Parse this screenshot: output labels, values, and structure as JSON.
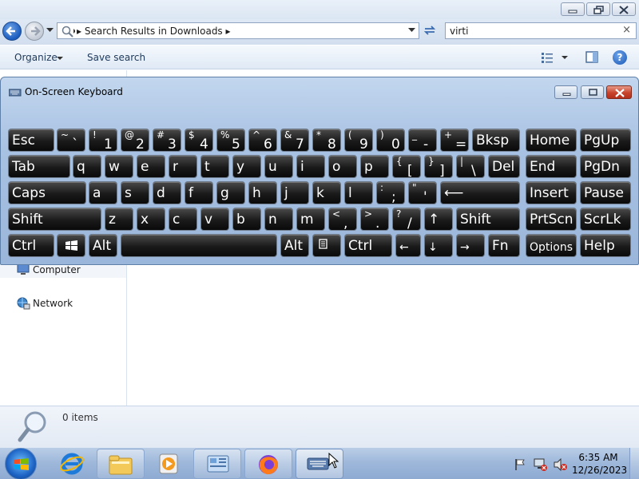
{
  "explorer": {
    "address": "Search Results in Downloads",
    "search_value": "virti",
    "search_clear": "×",
    "organize_label": "Organize",
    "save_search_label": "Save search",
    "help_label": "?",
    "nav_items": [
      {
        "label": "Computer"
      },
      {
        "label": "Network"
      }
    ],
    "details_count": "0 items"
  },
  "osk": {
    "title": "On-Screen Keyboard",
    "keys": [
      {
        "main": "Esc",
        "shift": "",
        "low": ""
      },
      {
        "main": "",
        "shift": "~",
        "low": "`"
      },
      {
        "main": "",
        "shift": "!",
        "low": "1"
      },
      {
        "main": "",
        "shift": "@",
        "low": "2"
      },
      {
        "main": "",
        "shift": "#",
        "low": "3"
      },
      {
        "main": "",
        "shift": "$",
        "low": "4"
      },
      {
        "main": "",
        "shift": "%",
        "low": "5"
      },
      {
        "main": "",
        "shift": "^",
        "low": "6"
      },
      {
        "main": "",
        "shift": "&",
        "low": "7"
      },
      {
        "main": "",
        "shift": "*",
        "low": "8"
      },
      {
        "main": "",
        "shift": "(",
        "low": "9"
      },
      {
        "main": "",
        "shift": ")",
        "low": "0"
      },
      {
        "main": "",
        "shift": "_",
        "low": "-"
      },
      {
        "main": "",
        "shift": "+",
        "low": "="
      },
      {
        "main": "Bksp",
        "shift": "",
        "low": ""
      },
      {
        "main": "Home",
        "shift": "",
        "low": ""
      },
      {
        "main": "PgUp",
        "shift": "",
        "low": ""
      },
      {
        "main": "Tab",
        "shift": "",
        "low": ""
      },
      {
        "main": "q",
        "shift": "",
        "low": ""
      },
      {
        "main": "w",
        "shift": "",
        "low": ""
      },
      {
        "main": "e",
        "shift": "",
        "low": ""
      },
      {
        "main": "r",
        "shift": "",
        "low": ""
      },
      {
        "main": "t",
        "shift": "",
        "low": ""
      },
      {
        "main": "y",
        "shift": "",
        "low": ""
      },
      {
        "main": "u",
        "shift": "",
        "low": ""
      },
      {
        "main": "i",
        "shift": "",
        "low": ""
      },
      {
        "main": "o",
        "shift": "",
        "low": ""
      },
      {
        "main": "p",
        "shift": "",
        "low": ""
      },
      {
        "main": "",
        "shift": "{",
        "low": "["
      },
      {
        "main": "",
        "shift": "}",
        "low": "]"
      },
      {
        "main": "",
        "shift": "|",
        "low": "\\"
      },
      {
        "main": "Del",
        "shift": "",
        "low": ""
      },
      {
        "main": "End",
        "shift": "",
        "low": ""
      },
      {
        "main": "PgDn",
        "shift": "",
        "low": ""
      },
      {
        "main": "Caps",
        "shift": "",
        "low": ""
      },
      {
        "main": "a",
        "shift": "",
        "low": ""
      },
      {
        "main": "s",
        "shift": "",
        "low": ""
      },
      {
        "main": "d",
        "shift": "",
        "low": ""
      },
      {
        "main": "f",
        "shift": "",
        "low": ""
      },
      {
        "main": "g",
        "shift": "",
        "low": ""
      },
      {
        "main": "h",
        "shift": "",
        "low": ""
      },
      {
        "main": "j",
        "shift": "",
        "low": ""
      },
      {
        "main": "k",
        "shift": "",
        "low": ""
      },
      {
        "main": "l",
        "shift": "",
        "low": ""
      },
      {
        "main": "",
        "shift": ":",
        "low": ";"
      },
      {
        "main": "",
        "shift": "\"",
        "low": "'"
      },
      {
        "main": "⟵",
        "shift": "",
        "low": ""
      },
      {
        "main": "Insert",
        "shift": "",
        "low": ""
      },
      {
        "main": "Pause",
        "shift": "",
        "low": ""
      },
      {
        "main": "Shift",
        "shift": "",
        "low": ""
      },
      {
        "main": "z",
        "shift": "",
        "low": ""
      },
      {
        "main": "x",
        "shift": "",
        "low": ""
      },
      {
        "main": "c",
        "shift": "",
        "low": ""
      },
      {
        "main": "v",
        "shift": "",
        "low": ""
      },
      {
        "main": "b",
        "shift": "",
        "low": ""
      },
      {
        "main": "n",
        "shift": "",
        "low": ""
      },
      {
        "main": "m",
        "shift": "",
        "low": ""
      },
      {
        "main": "",
        "shift": "<",
        "low": ","
      },
      {
        "main": "",
        "shift": ">",
        "low": "."
      },
      {
        "main": "",
        "shift": "?",
        "low": "/"
      },
      {
        "main": "↑",
        "shift": "",
        "low": ""
      },
      {
        "main": "Shift",
        "shift": "",
        "low": ""
      },
      {
        "main": "PrtScn",
        "shift": "",
        "low": ""
      },
      {
        "main": "ScrLk",
        "shift": "",
        "low": ""
      },
      {
        "main": "Ctrl",
        "shift": "",
        "low": ""
      },
      {
        "main": "",
        "shift": "",
        "low": ""
      },
      {
        "main": "Alt",
        "shift": "",
        "low": ""
      },
      {
        "main": "",
        "shift": "",
        "low": ""
      },
      {
        "main": "Alt",
        "shift": "",
        "low": ""
      },
      {
        "main": "",
        "shift": "",
        "low": ""
      },
      {
        "main": "Ctrl",
        "shift": "",
        "low": ""
      },
      {
        "main": "←",
        "shift": "",
        "low": ""
      },
      {
        "main": "↓",
        "shift": "",
        "low": ""
      },
      {
        "main": "→",
        "shift": "",
        "low": ""
      },
      {
        "main": "Fn",
        "shift": "",
        "low": ""
      },
      {
        "main": "Options",
        "shift": "",
        "low": ""
      },
      {
        "main": "Help",
        "shift": "",
        "low": ""
      }
    ]
  },
  "taskbar": {
    "time": "6:35 AM",
    "date": "12/26/2023"
  }
}
